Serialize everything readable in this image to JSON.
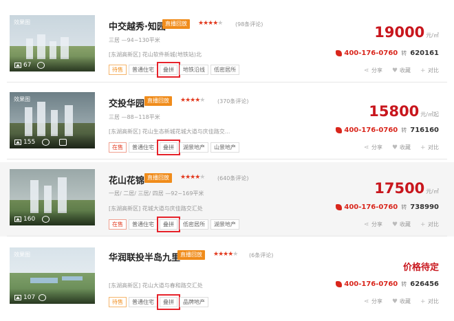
{
  "listings": [
    {
      "name": "中交越秀·知园",
      "live": "直播回放",
      "reviews": "(98条评论)",
      "layout": "三居 —94~130平米",
      "address": "[东湖高新区] 花山软件新城(地铁站)北",
      "tags": [
        "待售",
        "普通住宅",
        "叠拼",
        "地铁沿线",
        "低密居所"
      ],
      "image_tag": "效果图",
      "photos": "67",
      "price": "19000",
      "price_unit": "元/㎡",
      "phone": "400-176-0760",
      "zhuan": "转",
      "ext": "620161",
      "share": "分享",
      "fav": "收藏",
      "compare": "对比"
    },
    {
      "name": "交投华园",
      "live": "直播回放",
      "reviews": "(370条评论)",
      "layout": "三居 —88~118平米",
      "address": "[东湖高新区] 花山生态新城花城大道与庆佳路交...",
      "tags": [
        "在售",
        "普通住宅",
        "叠拼",
        "湖景地产",
        "山景地产"
      ],
      "image_tag": "效果图",
      "photos": "155",
      "price": "15800",
      "price_unit": "元/㎡起",
      "phone": "400-176-0760",
      "zhuan": "转",
      "ext": "716160",
      "share": "分享",
      "fav": "收藏",
      "compare": "对比"
    },
    {
      "name": "花山花锦",
      "live": "直播回放",
      "reviews": "(640条评论)",
      "layout": "一居/ 二居/ 三居/ 四居 —92~169平米",
      "address": "[东湖高新区] 花城大道与庆佳路交汇处",
      "tags": [
        "在售",
        "普通住宅",
        "叠拼",
        "低密居所",
        "湖景地产"
      ],
      "image_tag": "",
      "photos": "160",
      "price": "17500",
      "price_unit": "元/㎡",
      "phone": "400-176-0760",
      "zhuan": "转",
      "ext": "738990",
      "share": "分享",
      "fav": "收藏",
      "compare": "对比"
    },
    {
      "name": "华润联投半岛九里",
      "live": "直播回放",
      "reviews": "(6条评论)",
      "layout": "",
      "address": "[东湖高新区] 花山大道与春和路交汇处",
      "tags": [
        "待售",
        "普通住宅",
        "叠拼",
        "品牌地产"
      ],
      "image_tag": "效果图",
      "photos": "107",
      "price": "价格待定",
      "price_unit": "",
      "phone": "400-176-0760",
      "zhuan": "转",
      "ext": "626456",
      "share": "分享",
      "fav": "收藏",
      "compare": "对比"
    }
  ],
  "colors": {
    "accent_red": "#c8161d",
    "live_orange": "#f08c1b",
    "highlight_box": "#e62129"
  },
  "icons": [
    "picture-icon",
    "chat-icon",
    "phone-icon",
    "share-icon",
    "heart-icon",
    "plus-icon",
    "star-icon"
  ]
}
